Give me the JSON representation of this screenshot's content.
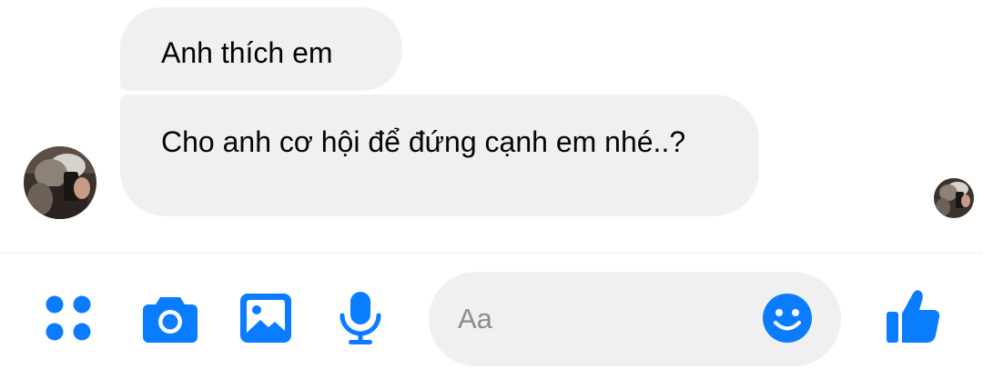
{
  "conversation": {
    "messages": [
      {
        "text": "Anh thích em"
      },
      {
        "text": "Cho anh cơ hội để đứng cạnh em nhé..?"
      }
    ]
  },
  "composer": {
    "placeholder": "Aa",
    "icons": [
      "more-icon",
      "camera-icon",
      "image-icon",
      "microphone-icon",
      "emoji-icon",
      "thumbs-up-icon"
    ]
  },
  "colors": {
    "accent": "#0a7cff",
    "bubble": "#f0f0f0",
    "text": "#050505",
    "placeholder": "#8a8d91"
  }
}
